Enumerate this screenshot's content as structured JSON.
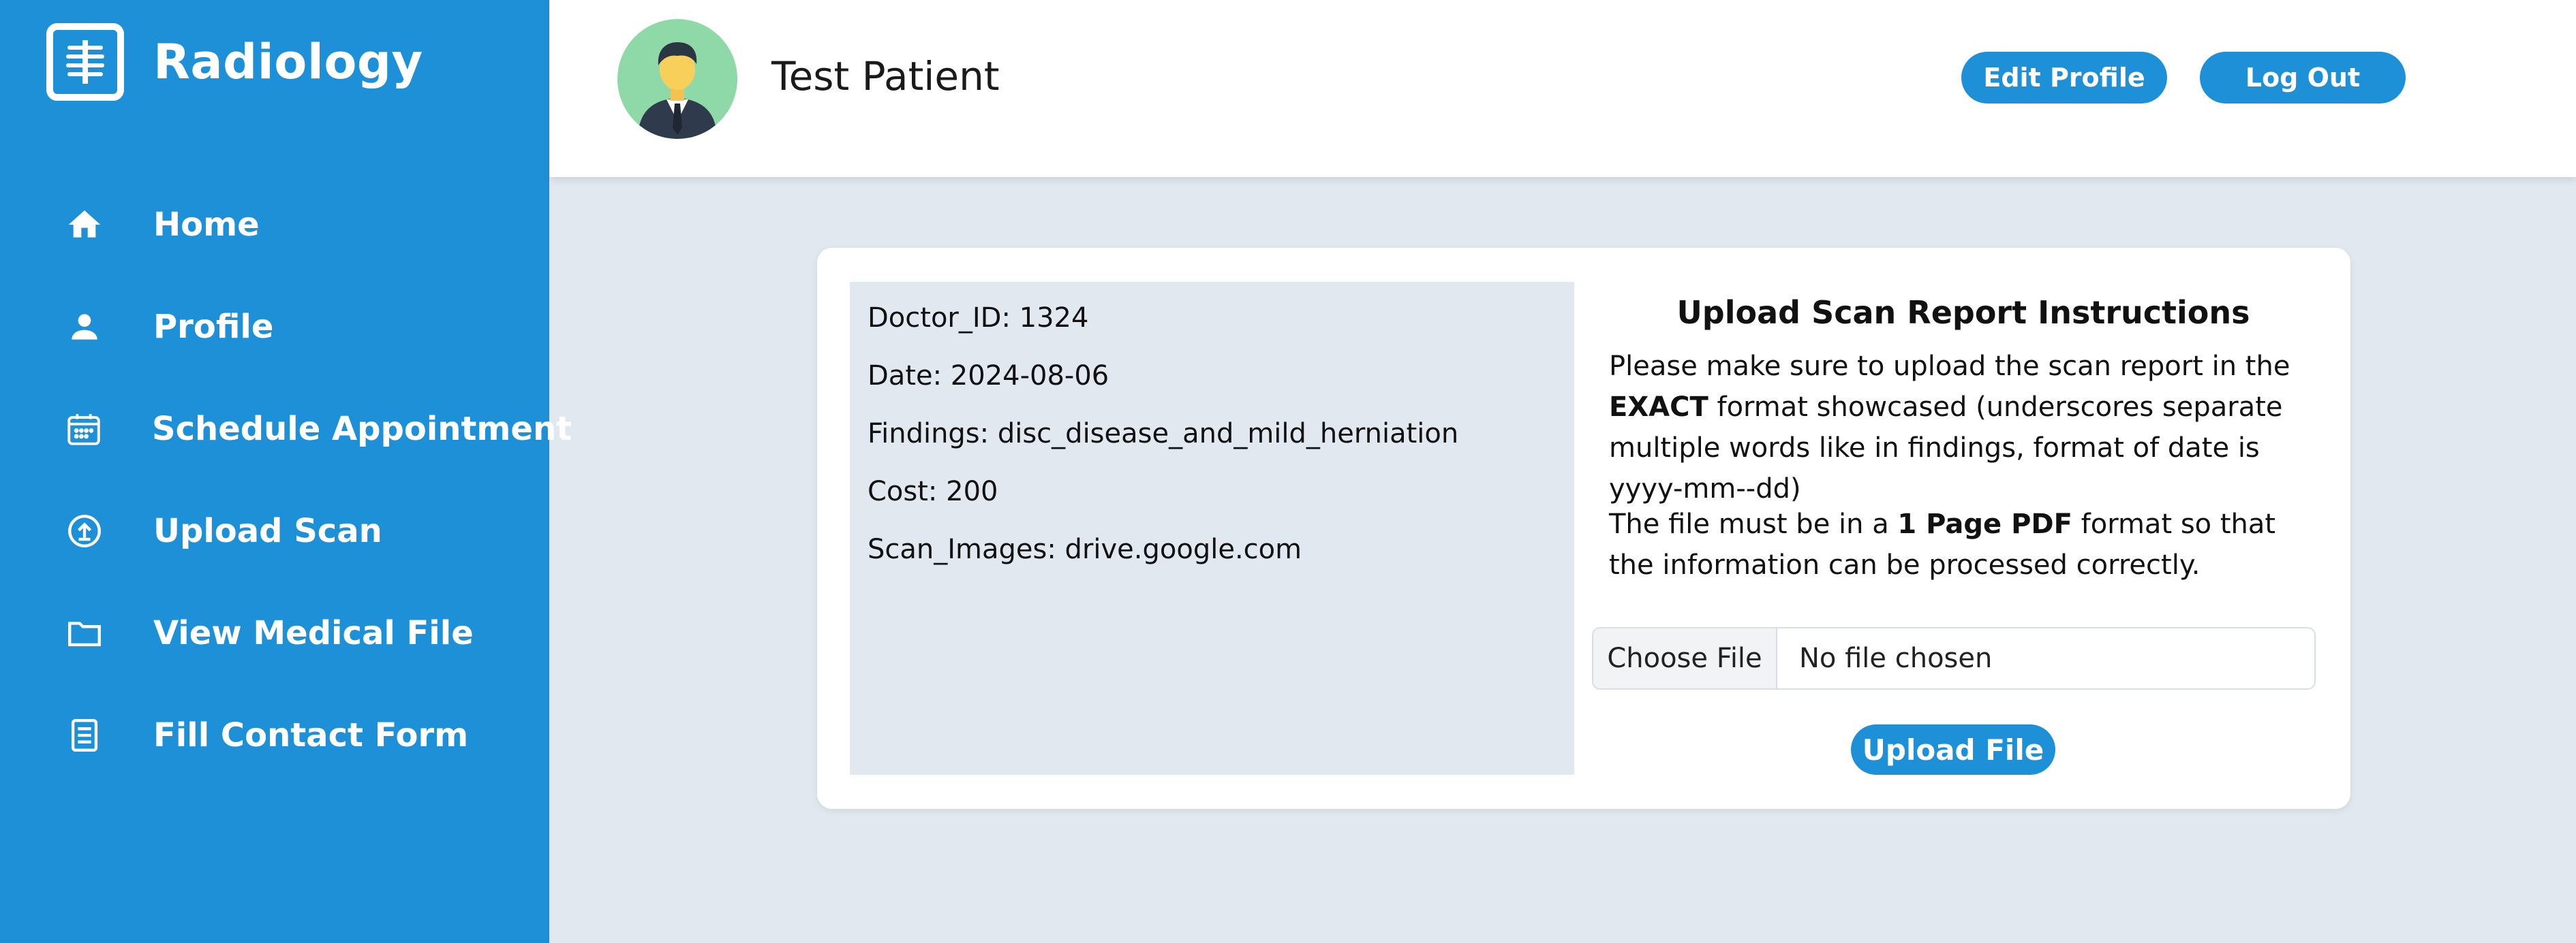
{
  "brand": {
    "title": "Radiology",
    "logo_icon": "xray-ribcage-icon"
  },
  "sidebar": {
    "items": [
      {
        "label": "Home",
        "icon": "home-icon"
      },
      {
        "label": "Profile",
        "icon": "person-icon"
      },
      {
        "label": "Schedule Appointment",
        "icon": "calendar-icon"
      },
      {
        "label": "Upload Scan",
        "icon": "upload-circle-icon"
      },
      {
        "label": "View Medical File",
        "icon": "folder-icon"
      },
      {
        "label": "Fill Contact Form",
        "icon": "form-icon"
      }
    ]
  },
  "header": {
    "user_name": "Test Patient",
    "avatar_icon": "user-avatar-icon",
    "edit_profile_label": "Edit Profile",
    "logout_label": "Log Out"
  },
  "scan_info": {
    "doctor_id": "Doctor_ID: 1324",
    "date": "Date: 2024-08-06",
    "findings": "Findings: disc_disease_and_mild_herniation",
    "cost": "Cost: 200",
    "scan_images": "Scan_Images: drive.google.com"
  },
  "instructions": {
    "title": "Upload Scan Report Instructions",
    "p1_before": "Please make sure to upload the scan report in the ",
    "p1_bold": "EXACT",
    "p1_after": " format showcased (underscores separate multiple words like in findings, format of date is yyyy-mm--dd)",
    "p2_before": "The file must be in a ",
    "p2_bold": "1 Page PDF",
    "p2_after": " format so that the information can be processed correctly."
  },
  "upload": {
    "choose_label": "Choose File",
    "status": "No file chosen",
    "button_label": "Upload File"
  },
  "colors": {
    "primary": "#1e90d8",
    "background": "#e2e8f0",
    "card": "#ffffff",
    "avatar_bg": "#8fd9a8"
  }
}
